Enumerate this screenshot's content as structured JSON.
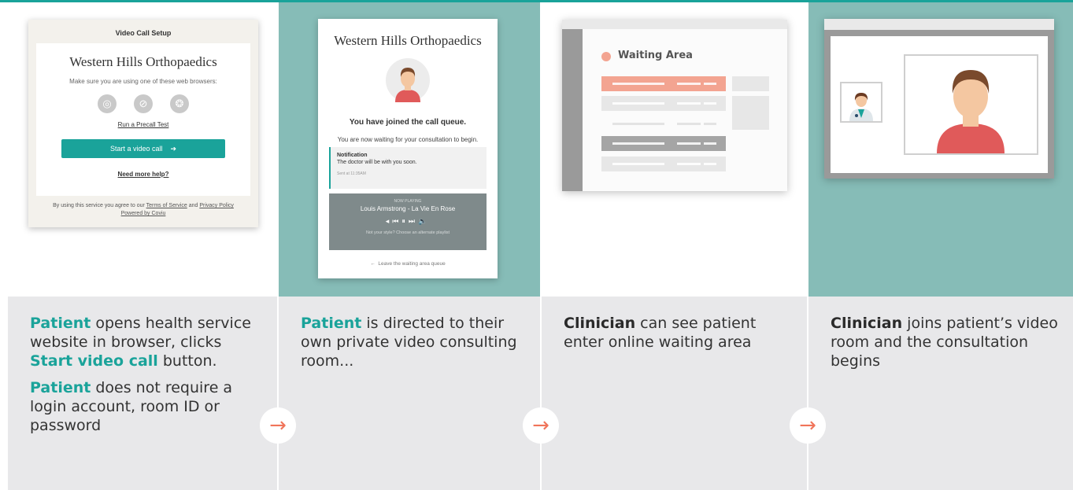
{
  "colors": {
    "accent": "#1aa39a",
    "arrow": "#f0745a",
    "teal_bg": "#86bcb7",
    "caption_bg": "#e8e8ea"
  },
  "panel1": {
    "card": {
      "header": "Video Call Setup",
      "clinic": "Western Hills Orthopaedics",
      "browsers_text": "Make sure you are using one of these web browsers:",
      "browsers": [
        "chrome-icon",
        "safari-icon",
        "firefox-icon"
      ],
      "precall_link": "Run a Precall Test",
      "start_button": "Start a video call",
      "help_link": "Need more help?",
      "footer_prefix": "By using this service you agree to our ",
      "terms_link": "Terms of Service",
      "footer_and": " and ",
      "privacy_link": "Privacy Policy",
      "powered_by": "Powered by Coviu"
    },
    "caption": {
      "p1_kw": "Patient",
      "p1_text": " opens health service website in browser, clicks ",
      "p1_kw2": "Start video call",
      "p1_tail": " button.",
      "p2_kw": "Patient",
      "p2_text": " does not require a login account, room ID or password"
    }
  },
  "panel2": {
    "card": {
      "clinic": "Western Hills Orthopaedics",
      "joined": "You have joined the call queue.",
      "waiting": "You are now waiting for your consultation to begin.",
      "notif_title": "Notification",
      "notif_body": "The doctor will be with you soon.",
      "notif_sent": "Sent at 11:35AM",
      "now_playing": "NOW PLAYING",
      "song": "Louis Armstrong - La Vie En Rose",
      "style_text": "Not your style? Choose an alternate playlist",
      "leave": "Leave the waiting area queue"
    },
    "caption": {
      "kw": "Patient",
      "text": " is directed to their own private video consulting room..."
    }
  },
  "panel3": {
    "screen": {
      "title": "Waiting Area"
    },
    "caption": {
      "kw": "Clinician",
      "text": " can see patient enter online waiting area"
    }
  },
  "panel4": {
    "caption": {
      "kw": "Clinician",
      "text": " joins patient’s video room and the consultation begins",
      "tail": "s"
    }
  },
  "arrows": {
    "glyph": "→"
  }
}
